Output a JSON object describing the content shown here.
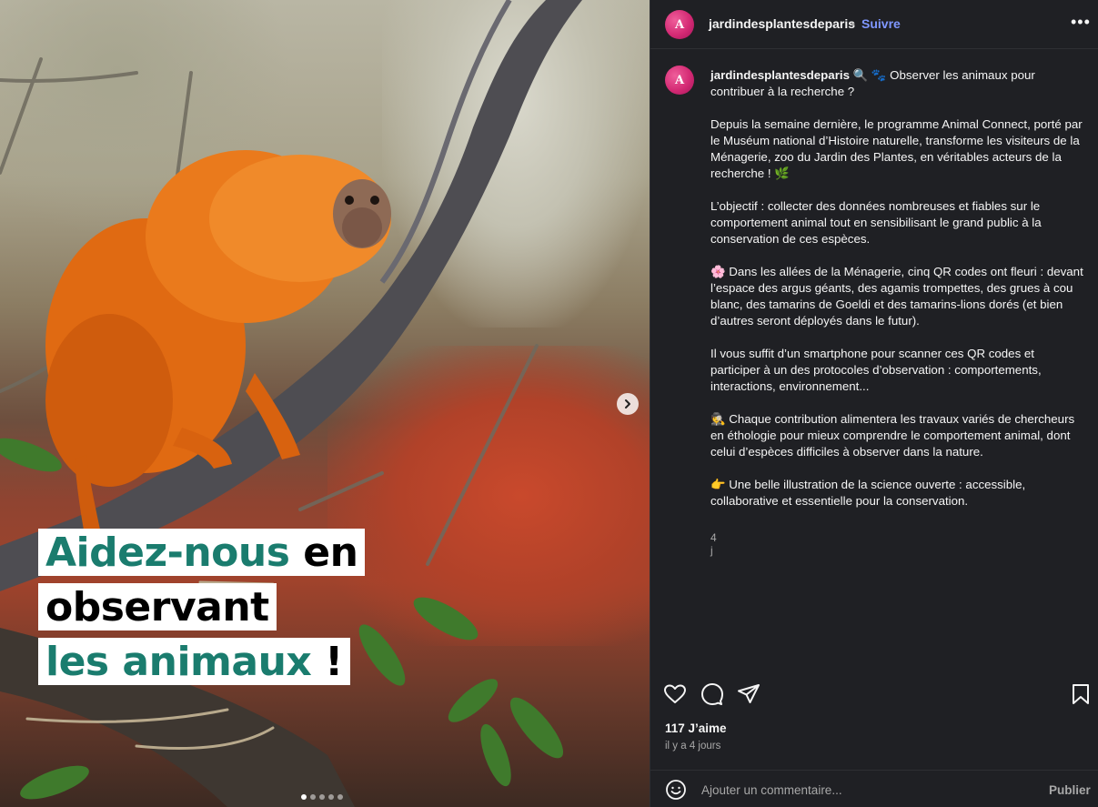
{
  "post": {
    "image_caption": {
      "line1_green": "Aidez-nous",
      "line1_black": "en",
      "line2_black": "observant",
      "line3_green": "les animaux",
      "line3_black": "!"
    },
    "carousel_dots": 5,
    "carousel_active_index": 0
  },
  "header": {
    "username": "jardindesplantesdeparis",
    "separator": "•",
    "follow_label": "Suivre",
    "more_label": "•••",
    "avatar_letter": "A"
  },
  "caption": {
    "username": "jardindesplantesdeparis",
    "first_line": "🔍 🐾 Observer les animaux pour contribuer à la recherche ?",
    "paragraphs": [
      "Depuis la semaine dernière, le programme Animal Connect, porté par le Muséum national d’Histoire naturelle, transforme les visiteurs de la Ménagerie, zoo du Jardin des Plantes, en véritables acteurs de la recherche ! 🌿",
      "L’objectif : collecter des données nombreuses et fiables sur le comportement animal tout en sensibilisant le grand public à la conservation de ces espèces.",
      "🌸 Dans les allées de la Ménagerie, cinq QR codes ont fleuri : devant l’espace des argus géants, des agamis trompettes, des grues à cou blanc, des tamarins de Goeldi et des tamarins-lions dorés (et bien d’autres seront déployés dans le futur).",
      "Il vous suffit d’un smartphone pour scanner ces QR codes et participer à un des protocoles d’observation : comportements, interactions, environnement...",
      "🕵 Chaque contribution alimentera les travaux variés de chercheurs en éthologie pour mieux comprendre le comportement animal, dont celui d’espèces difficiles à observer dans la nature.",
      "👉 Une belle illustration de la science ouverte : accessible, collaborative et essentielle pour la conservation."
    ],
    "time": "4 j"
  },
  "stats": {
    "likes": "117 J’aime",
    "date": "il y a 4 jours"
  },
  "comment_box": {
    "placeholder": "Ajouter un commentaire...",
    "publish_label": "Publier"
  },
  "colors": {
    "panel_bg": "#1f2024",
    "follow_blue": "#7f97ff",
    "caption_green": "#1a7c6e",
    "avatar_pink": "#d42a74"
  }
}
